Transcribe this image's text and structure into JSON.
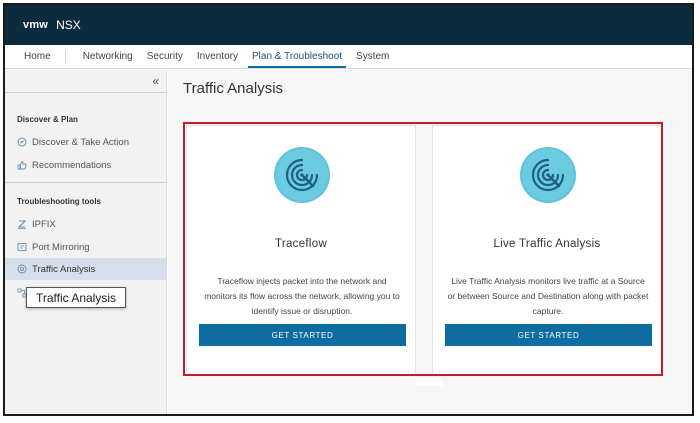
{
  "header": {
    "logo": "vmw",
    "product": "NSX"
  },
  "nav": {
    "tabs": [
      {
        "label": "Home"
      },
      {
        "label": "Networking"
      },
      {
        "label": "Security"
      },
      {
        "label": "Inventory"
      },
      {
        "label": "Plan & Troubleshoot",
        "active": true
      },
      {
        "label": "System"
      }
    ]
  },
  "sidebar": {
    "collapse_glyph": "«",
    "section1": "Discover & Plan",
    "section1_items": [
      {
        "label": "Discover & Take Action",
        "icon": "discover-icon"
      },
      {
        "label": "Recommendations",
        "icon": "recommendations-icon"
      }
    ],
    "section2": "Troubleshooting tools",
    "section2_items": [
      {
        "label": "IPFIX",
        "icon": "ipfix-icon"
      },
      {
        "label": "Port Mirroring",
        "icon": "port-mirroring-icon"
      },
      {
        "label": "Traffic Analysis",
        "icon": "traffic-analysis-icon",
        "active": true
      }
    ]
  },
  "tooltip": "Traffic Analysis",
  "main": {
    "title": "Traffic Analysis",
    "cards": [
      {
        "title": "Traceflow",
        "description": "Traceflow injects packet into the network and monitors its flow across the network, allowing you to identify issue or disruption.",
        "button": "GET STARTED",
        "icon": "radar-icon"
      },
      {
        "title": "Live Traffic Analysis",
        "description": "Live Traffic Analysis monitors live traffic at a Source or between Source and Destination along with packet capture.",
        "button": "GET STARTED",
        "icon": "radar-icon"
      }
    ]
  },
  "colors": {
    "header_bg": "#0c2b3e",
    "accent": "#0072a3",
    "button": "#0d6da1",
    "highlight": "#c21d28",
    "icon_teal": "#5fc3d9"
  }
}
